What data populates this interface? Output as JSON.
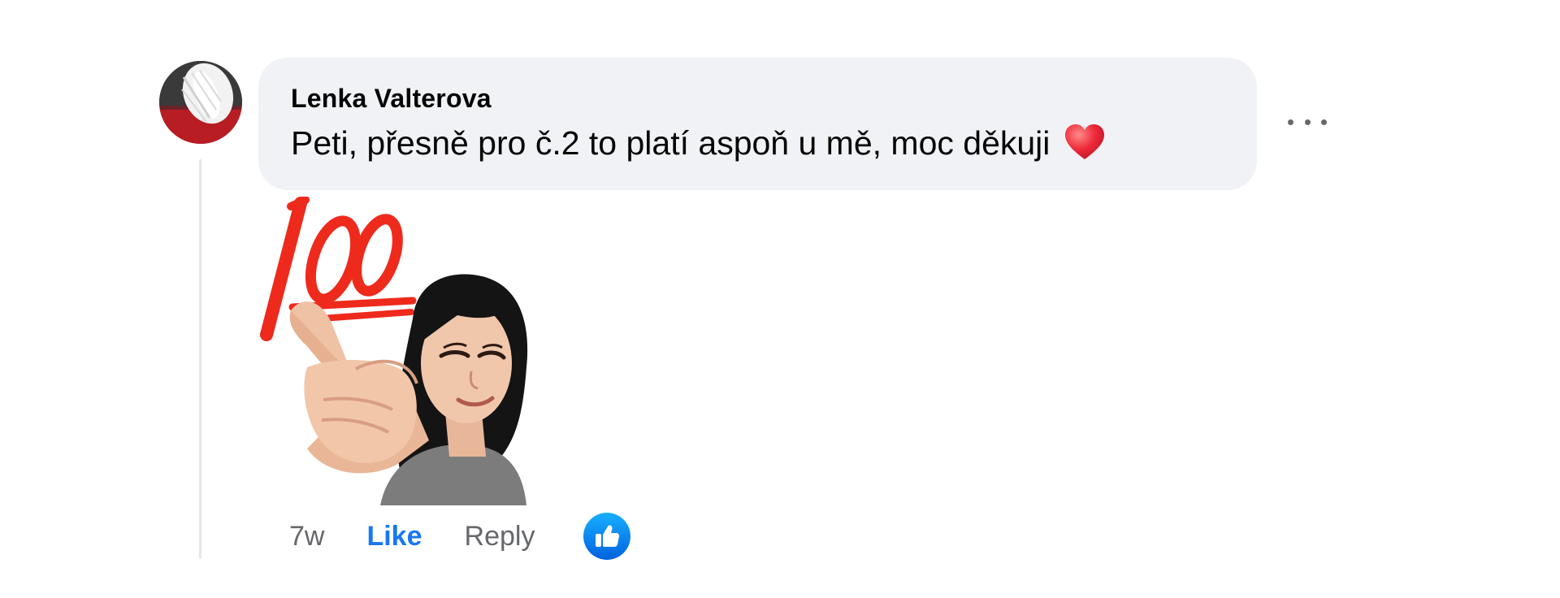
{
  "comment": {
    "author": "Lenka Valterova",
    "text": "Peti, přesně pro č.2 to platí aspoň u mě, moc děkuji",
    "emoji": "heart-icon",
    "sticker": "100-pointing-avatar-sticker"
  },
  "actions": {
    "time": "7w",
    "like_label": "Like",
    "reply_label": "Reply",
    "reaction": "like-icon"
  },
  "colors": {
    "bubble": "#f0f2f5",
    "like_blue": "#1877f2",
    "secondary_text": "#65676b",
    "heart": "#e0245e"
  }
}
